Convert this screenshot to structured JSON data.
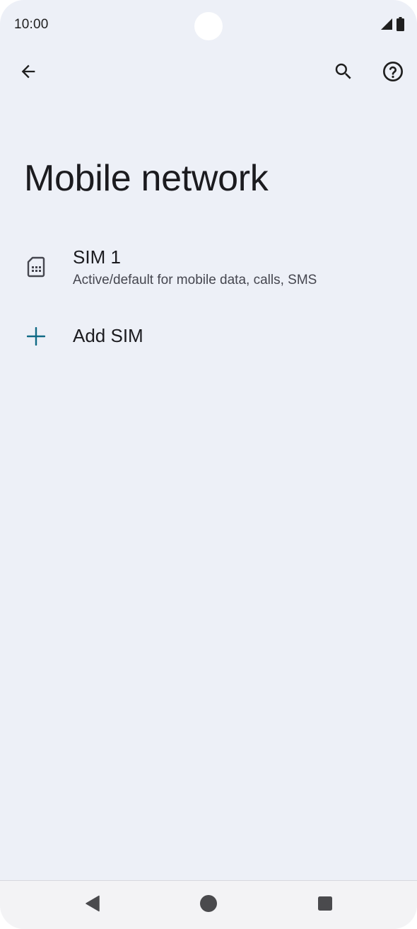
{
  "status_bar": {
    "time": "10:00",
    "icons": [
      "signal-icon",
      "battery-icon"
    ]
  },
  "toolbar": {
    "back_icon": "arrow-back-icon",
    "search_icon": "search-icon",
    "help_icon": "help-icon"
  },
  "page": {
    "title": "Mobile network"
  },
  "list": {
    "items": [
      {
        "title": "SIM 1",
        "summary": "Active/default for mobile data, calls, SMS",
        "icon": "sim-card-icon"
      },
      {
        "title": "Add SIM",
        "icon": "plus-icon"
      }
    ]
  },
  "nav_bar": {
    "icons": [
      "nav-back-icon",
      "nav-home-icon",
      "nav-recents-icon"
    ]
  },
  "colors": {
    "background": "#edf0f7",
    "text_primary": "#1b1b1f",
    "text_secondary": "#45464f",
    "accent": "#106a85"
  }
}
